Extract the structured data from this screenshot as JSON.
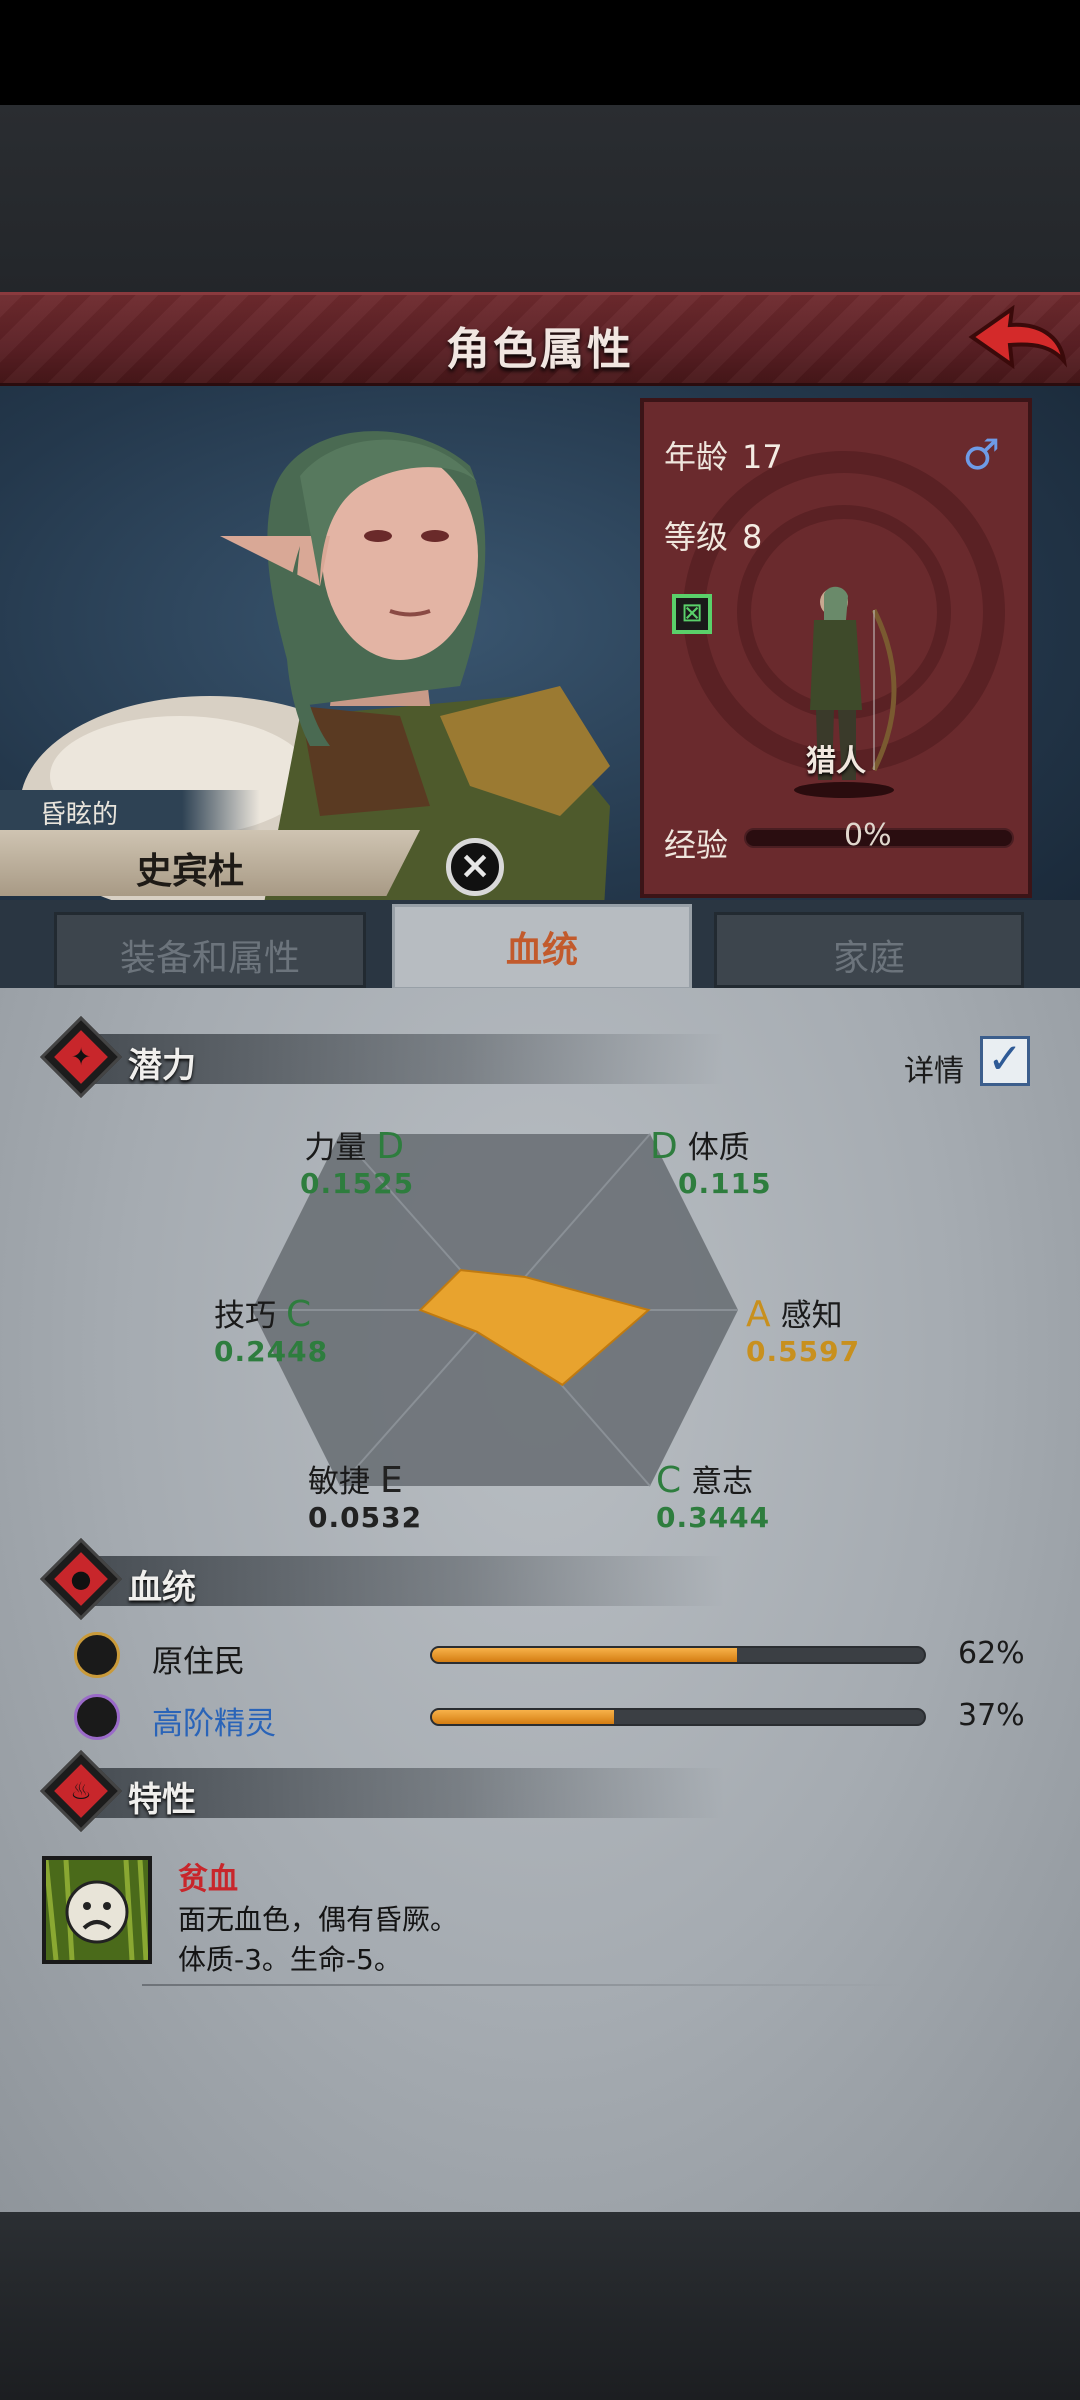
{
  "header": {
    "title": "角色属性",
    "back_icon": "back-arrow-icon"
  },
  "character": {
    "epithet": "昏眩的",
    "name": "史宾杜",
    "age_label": "年龄",
    "age": "17",
    "level_label": "等级",
    "level": "8",
    "gender_symbol": "♂",
    "class": "猎人",
    "exp_label": "经验",
    "exp_percent": "0%",
    "exp_progress": 0
  },
  "tabs": [
    {
      "label": "装备和属性",
      "active": false
    },
    {
      "label": "血统",
      "active": true
    },
    {
      "label": "家庭",
      "active": false
    }
  ],
  "potential": {
    "section_label": "潜力",
    "detail_label": "详情",
    "detail_checked": true,
    "stats": [
      {
        "name": "力量",
        "grade": "D",
        "value": "0.1525"
      },
      {
        "name": "体质",
        "grade": "D",
        "value": "0.115"
      },
      {
        "name": "感知",
        "grade": "A",
        "value": "0.5597"
      },
      {
        "name": "意志",
        "grade": "C",
        "value": "0.3444"
      },
      {
        "name": "敏捷",
        "grade": "E",
        "value": "0.0532"
      },
      {
        "name": "技巧",
        "grade": "C",
        "value": "0.2448"
      }
    ]
  },
  "bloodline": {
    "section_label": "血统",
    "items": [
      {
        "name": "原住民",
        "percent": "62%",
        "progress": 0.62
      },
      {
        "name": "高阶精灵",
        "percent": "37%",
        "progress": 0.37
      }
    ]
  },
  "traits": {
    "section_label": "特性",
    "items": [
      {
        "title": "贫血",
        "line1": "面无血色，偶有昏厥。",
        "line2": "体质-3。生命-5。"
      }
    ]
  },
  "colors": {
    "grade_green": "#2e7d3e",
    "grade_a": "#c8901e",
    "bar_fill": "#f0a030",
    "trait_title": "#c8262b",
    "title_bar": "#5a1f24",
    "elf_name": "#2a64b8"
  }
}
